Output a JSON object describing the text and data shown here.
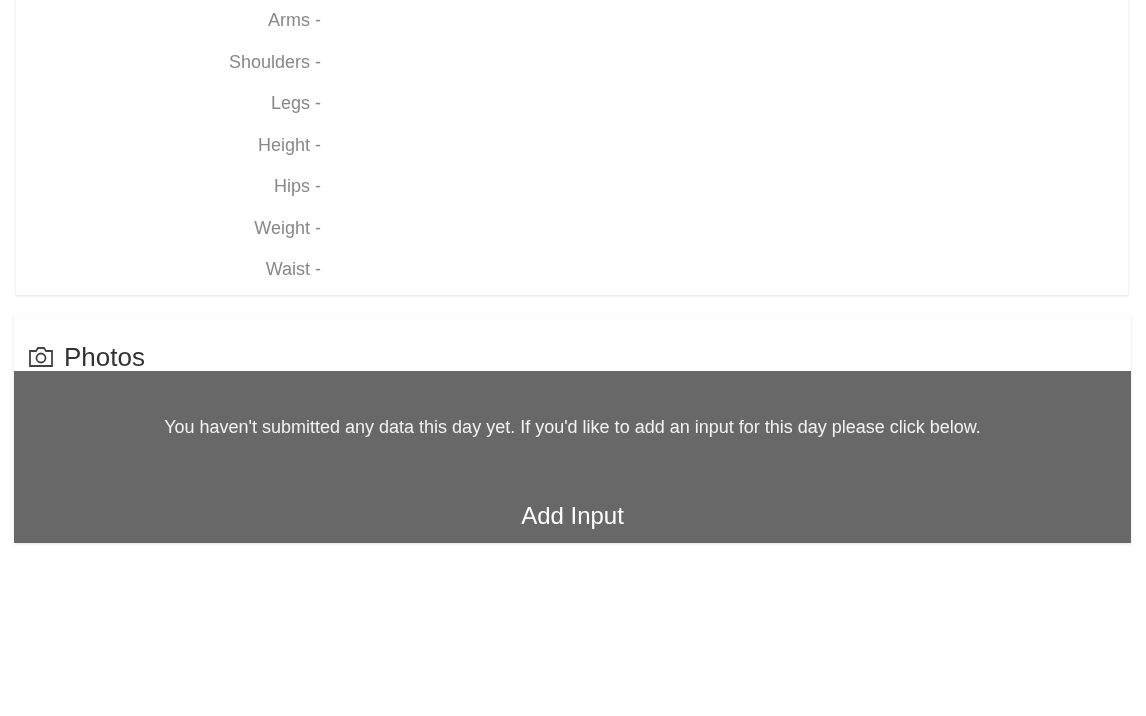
{
  "measurements": [
    {
      "label": "Arms -"
    },
    {
      "label": "Shoulders -"
    },
    {
      "label": "Legs -"
    },
    {
      "label": "Height -"
    },
    {
      "label": "Hips -"
    },
    {
      "label": "Weight -"
    },
    {
      "label": "Waist -"
    }
  ],
  "photos": {
    "title": "Photos"
  },
  "notice": {
    "message": "You haven't submitted any data this day yet. If you'd like to add an input for this day please click below.",
    "button": "Add Input"
  }
}
